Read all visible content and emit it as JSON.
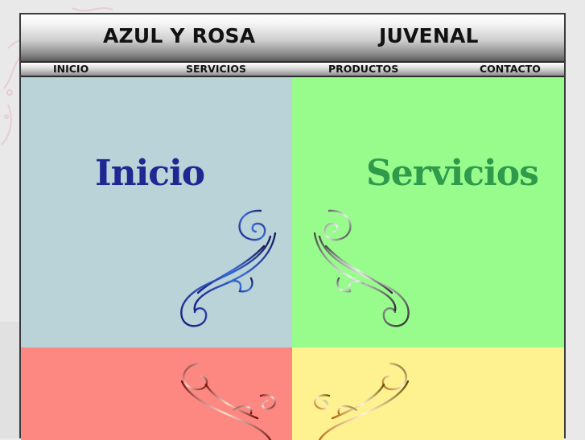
{
  "header": {
    "brand_left": "AZUL Y ROSA",
    "brand_right": "JUVENAL"
  },
  "nav": {
    "items": [
      "INICIO",
      "SERVICIOS",
      "PRODUCTOS",
      "CONTACTO"
    ]
  },
  "tiles": [
    {
      "title": "Inicio",
      "color": "#b9d3d9",
      "title_color": "#1f2790"
    },
    {
      "title": "Servicios",
      "color": "#98fc8d",
      "title_color": "#2e9a4a"
    },
    {
      "title": "",
      "color": "#fd8882"
    },
    {
      "title": "",
      "color": "#fdf28f"
    }
  ],
  "icons": [
    "swirl-ornament-icon"
  ]
}
